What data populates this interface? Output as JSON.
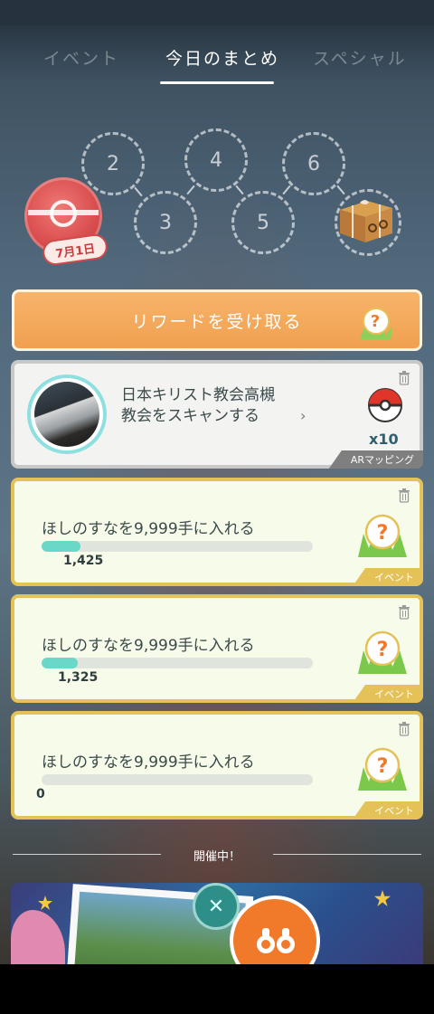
{
  "tabs": [
    {
      "label": "イベント"
    },
    {
      "label": "今日のまとめ"
    },
    {
      "label": "スペシャル"
    }
  ],
  "stamps": {
    "day_label": "7月1日",
    "days": [
      "2",
      "3",
      "4",
      "5",
      "6"
    ]
  },
  "reward_button": {
    "label": "リワードを受け取る"
  },
  "ar_task": {
    "title": "日本キリスト教会高槻教会をスキャンする",
    "reward_count": "x10",
    "tag": "ARマッピング"
  },
  "event_tasks": [
    {
      "title": "ほしのすなを9,999手に入れる",
      "value": "1,425",
      "progress": 0.1425,
      "tag": "イベント"
    },
    {
      "title": "ほしのすなを9,999手に入れる",
      "value": "1,325",
      "progress": 0.1325,
      "tag": "イベント"
    },
    {
      "title": "ほしのすなを9,999手に入れる",
      "value": "0",
      "progress": 0,
      "tag": "イベント"
    }
  ],
  "section_label": "開催中！",
  "colors": {
    "reward": "#f0a050",
    "event_border": "#e4c257",
    "progress": "#6ad8c8",
    "ar_border": "#c8c8c8"
  }
}
